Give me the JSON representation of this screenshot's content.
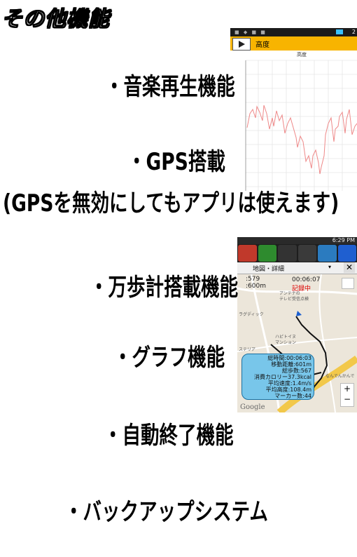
{
  "heading": "その他機能",
  "features": {
    "music": "・音楽再生機能",
    "gps": "・GPS搭載",
    "gps_note": "(GPSを無効にしてもアプリは使えます)",
    "pedometer": "・万歩計搭載機能",
    "graph": "・グラフ機能",
    "autostop": "・自動終了機能",
    "backup": "・バックアップシステム"
  },
  "phone1": {
    "time": "2",
    "toolbar_title": "高度",
    "chart_title": "高度"
  },
  "phone2": {
    "time": "6:29 PM",
    "map_mode": "地図・詳細",
    "stat_line1": ":579",
    "stat_line2": ":600m",
    "elapsed": "00:06:07",
    "recording": "記録中",
    "map_labels": [
      "アンテナの",
      "テレビ受信点検",
      "ラグディック",
      "ハピトイヌ",
      "マンション",
      "ステリア",
      "なんでんかんで"
    ],
    "summary": [
      "総時間:00:06:03",
      "移動距離:601m",
      "総歩数:567",
      "消費カロリー37.3kcal",
      "平均速度:1.4m/s",
      "平均高度:108.4m",
      "マーカー数:44"
    ],
    "google": "Google",
    "zoom_in": "+",
    "zoom_out": "−",
    "close": "✕"
  }
}
